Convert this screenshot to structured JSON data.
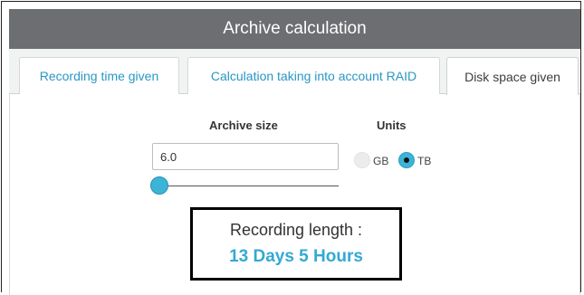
{
  "header": {
    "title": "Archive calculation"
  },
  "tabs": [
    {
      "label": "Recording time given",
      "active": false
    },
    {
      "label": "Calculation taking into account RAID",
      "active": false
    },
    {
      "label": "Disk space given",
      "active": true
    }
  ],
  "form": {
    "archive_size_label": "Archive size",
    "archive_size_value": "6.0",
    "units_label": "Units",
    "unit_options": [
      "GB",
      "TB"
    ],
    "selected_unit": "TB",
    "slider_fraction": 0
  },
  "result": {
    "title": "Recording length :",
    "value": "13 Days 5 Hours"
  },
  "colors": {
    "header_bg": "#6d6e71",
    "accent": "#3cb4d8",
    "tab_link": "#2a97c4",
    "result_value": "#33a9d3"
  }
}
